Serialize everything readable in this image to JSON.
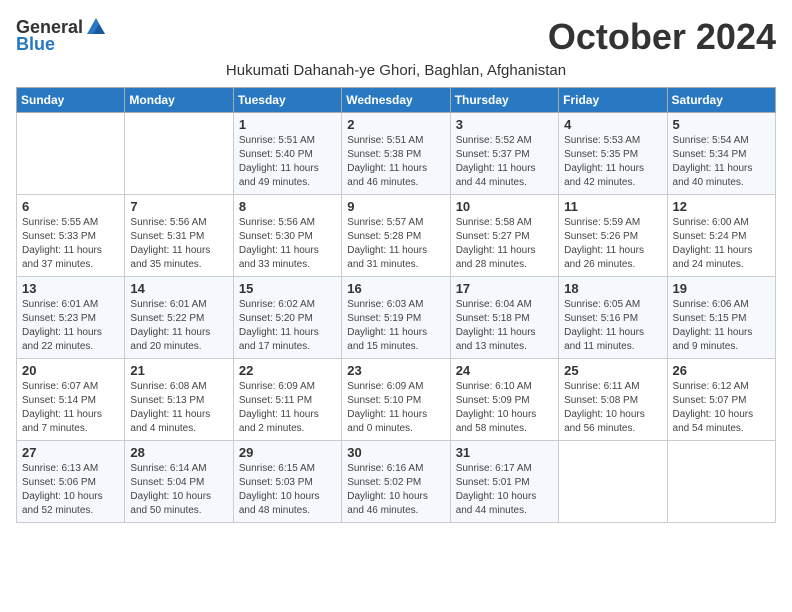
{
  "logo": {
    "general": "General",
    "blue": "Blue"
  },
  "title": "October 2024",
  "subtitle": "Hukumati Dahanah-ye Ghori, Baghlan, Afghanistan",
  "days_of_week": [
    "Sunday",
    "Monday",
    "Tuesday",
    "Wednesday",
    "Thursday",
    "Friday",
    "Saturday"
  ],
  "weeks": [
    [
      {
        "day": "",
        "info": ""
      },
      {
        "day": "",
        "info": ""
      },
      {
        "day": "1",
        "info": "Sunrise: 5:51 AM\nSunset: 5:40 PM\nDaylight: 11 hours and 49 minutes."
      },
      {
        "day": "2",
        "info": "Sunrise: 5:51 AM\nSunset: 5:38 PM\nDaylight: 11 hours and 46 minutes."
      },
      {
        "day": "3",
        "info": "Sunrise: 5:52 AM\nSunset: 5:37 PM\nDaylight: 11 hours and 44 minutes."
      },
      {
        "day": "4",
        "info": "Sunrise: 5:53 AM\nSunset: 5:35 PM\nDaylight: 11 hours and 42 minutes."
      },
      {
        "day": "5",
        "info": "Sunrise: 5:54 AM\nSunset: 5:34 PM\nDaylight: 11 hours and 40 minutes."
      }
    ],
    [
      {
        "day": "6",
        "info": "Sunrise: 5:55 AM\nSunset: 5:33 PM\nDaylight: 11 hours and 37 minutes."
      },
      {
        "day": "7",
        "info": "Sunrise: 5:56 AM\nSunset: 5:31 PM\nDaylight: 11 hours and 35 minutes."
      },
      {
        "day": "8",
        "info": "Sunrise: 5:56 AM\nSunset: 5:30 PM\nDaylight: 11 hours and 33 minutes."
      },
      {
        "day": "9",
        "info": "Sunrise: 5:57 AM\nSunset: 5:28 PM\nDaylight: 11 hours and 31 minutes."
      },
      {
        "day": "10",
        "info": "Sunrise: 5:58 AM\nSunset: 5:27 PM\nDaylight: 11 hours and 28 minutes."
      },
      {
        "day": "11",
        "info": "Sunrise: 5:59 AM\nSunset: 5:26 PM\nDaylight: 11 hours and 26 minutes."
      },
      {
        "day": "12",
        "info": "Sunrise: 6:00 AM\nSunset: 5:24 PM\nDaylight: 11 hours and 24 minutes."
      }
    ],
    [
      {
        "day": "13",
        "info": "Sunrise: 6:01 AM\nSunset: 5:23 PM\nDaylight: 11 hours and 22 minutes."
      },
      {
        "day": "14",
        "info": "Sunrise: 6:01 AM\nSunset: 5:22 PM\nDaylight: 11 hours and 20 minutes."
      },
      {
        "day": "15",
        "info": "Sunrise: 6:02 AM\nSunset: 5:20 PM\nDaylight: 11 hours and 17 minutes."
      },
      {
        "day": "16",
        "info": "Sunrise: 6:03 AM\nSunset: 5:19 PM\nDaylight: 11 hours and 15 minutes."
      },
      {
        "day": "17",
        "info": "Sunrise: 6:04 AM\nSunset: 5:18 PM\nDaylight: 11 hours and 13 minutes."
      },
      {
        "day": "18",
        "info": "Sunrise: 6:05 AM\nSunset: 5:16 PM\nDaylight: 11 hours and 11 minutes."
      },
      {
        "day": "19",
        "info": "Sunrise: 6:06 AM\nSunset: 5:15 PM\nDaylight: 11 hours and 9 minutes."
      }
    ],
    [
      {
        "day": "20",
        "info": "Sunrise: 6:07 AM\nSunset: 5:14 PM\nDaylight: 11 hours and 7 minutes."
      },
      {
        "day": "21",
        "info": "Sunrise: 6:08 AM\nSunset: 5:13 PM\nDaylight: 11 hours and 4 minutes."
      },
      {
        "day": "22",
        "info": "Sunrise: 6:09 AM\nSunset: 5:11 PM\nDaylight: 11 hours and 2 minutes."
      },
      {
        "day": "23",
        "info": "Sunrise: 6:09 AM\nSunset: 5:10 PM\nDaylight: 11 hours and 0 minutes."
      },
      {
        "day": "24",
        "info": "Sunrise: 6:10 AM\nSunset: 5:09 PM\nDaylight: 10 hours and 58 minutes."
      },
      {
        "day": "25",
        "info": "Sunrise: 6:11 AM\nSunset: 5:08 PM\nDaylight: 10 hours and 56 minutes."
      },
      {
        "day": "26",
        "info": "Sunrise: 6:12 AM\nSunset: 5:07 PM\nDaylight: 10 hours and 54 minutes."
      }
    ],
    [
      {
        "day": "27",
        "info": "Sunrise: 6:13 AM\nSunset: 5:06 PM\nDaylight: 10 hours and 52 minutes."
      },
      {
        "day": "28",
        "info": "Sunrise: 6:14 AM\nSunset: 5:04 PM\nDaylight: 10 hours and 50 minutes."
      },
      {
        "day": "29",
        "info": "Sunrise: 6:15 AM\nSunset: 5:03 PM\nDaylight: 10 hours and 48 minutes."
      },
      {
        "day": "30",
        "info": "Sunrise: 6:16 AM\nSunset: 5:02 PM\nDaylight: 10 hours and 46 minutes."
      },
      {
        "day": "31",
        "info": "Sunrise: 6:17 AM\nSunset: 5:01 PM\nDaylight: 10 hours and 44 minutes."
      },
      {
        "day": "",
        "info": ""
      },
      {
        "day": "",
        "info": ""
      }
    ]
  ]
}
